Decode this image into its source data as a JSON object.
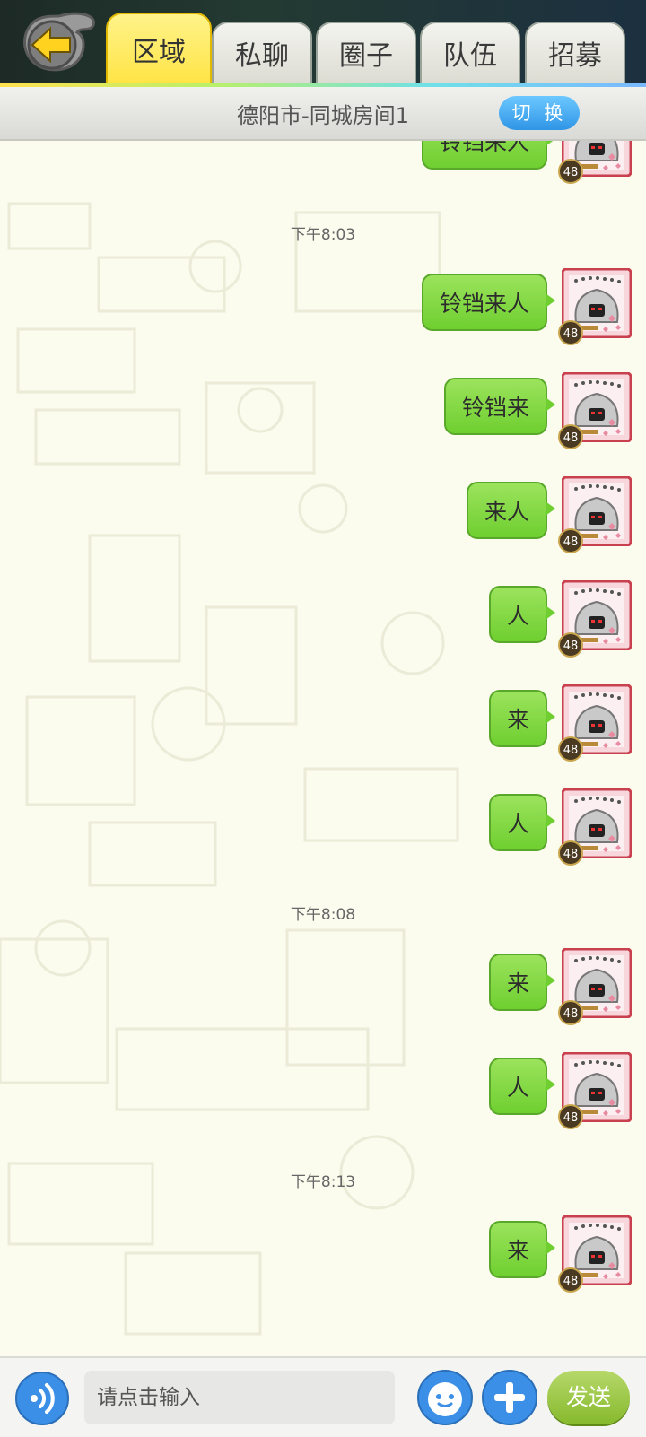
{
  "tabs": [
    {
      "label": "区域",
      "active": true
    },
    {
      "label": "私聊",
      "active": false
    },
    {
      "label": "圈子",
      "active": false
    },
    {
      "label": "队伍",
      "active": false
    },
    {
      "label": "招募",
      "active": false
    }
  ],
  "room": {
    "name": "德阳市-同城房间1",
    "switch_label": "切 换"
  },
  "messages": [
    {
      "text": "铃铛来人",
      "level": "48"
    },
    {
      "timestamp": "下午8:03"
    },
    {
      "text": "铃铛来人",
      "level": "48"
    },
    {
      "text": "铃铛来",
      "level": "48"
    },
    {
      "text": "来人",
      "level": "48"
    },
    {
      "text": "人",
      "level": "48"
    },
    {
      "text": "来",
      "level": "48"
    },
    {
      "text": "人",
      "level": "48"
    },
    {
      "timestamp": "下午8:08"
    },
    {
      "text": "来",
      "level": "48"
    },
    {
      "text": "人",
      "level": "48"
    },
    {
      "timestamp": "下午8:13"
    },
    {
      "text": "来",
      "level": "48"
    }
  ],
  "input": {
    "placeholder": "请点击输入",
    "send_label": "发送"
  },
  "colors": {
    "active_tab": "#ffe445",
    "bubble": "#7fd83c",
    "switch_button": "#3ea4ef",
    "send_button": "#98c640",
    "action_buttons": "#3b8fe6"
  },
  "icons": {
    "back": "back-arrow-icon",
    "voice": "voice-icon",
    "emoji": "emoji-icon",
    "plus": "plus-icon"
  }
}
